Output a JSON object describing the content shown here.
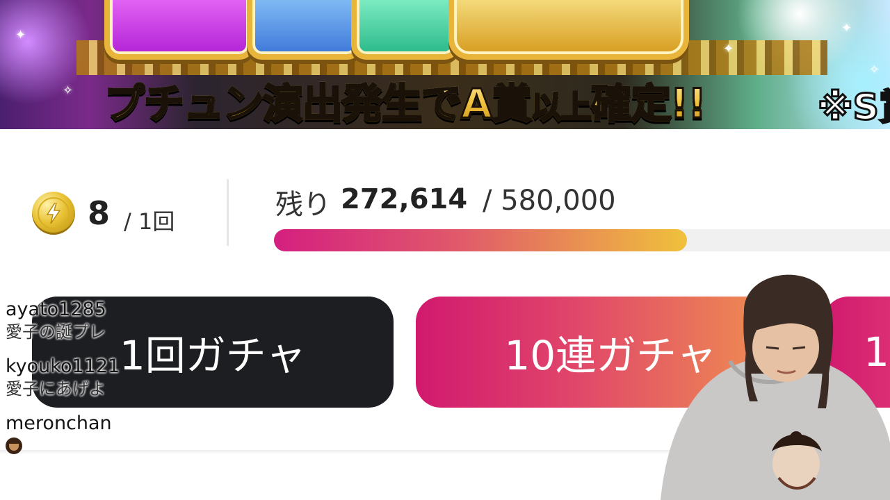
{
  "banner": {
    "caption_main": "プチュン演出発生でA賞",
    "caption_small": "以上",
    "caption_end": "確定!!",
    "note": "※S賞"
  },
  "gacha_cost": {
    "value": "8",
    "unit": "/ 1回",
    "icon": "lightning-coin-icon"
  },
  "stock": {
    "remaining_label": "残り",
    "remaining_value": "272,614",
    "total": "/ 580,000",
    "remaining_fraction": 0.47
  },
  "buttons": {
    "single": "1回ガチャ",
    "ten": "10連ガチャ",
    "third": "1"
  },
  "chat": [
    {
      "user": "ayato1285",
      "text": "愛子の誕プレ"
    },
    {
      "user": "kyouko1121",
      "text": "愛子にあげよ"
    },
    {
      "user": "meronchan",
      "text": "",
      "icon": "person-emoji-icon"
    }
  ],
  "colors": {
    "accent_start": "#d1196f",
    "accent_end": "#f19a4e",
    "progress_end": "#f0c13c",
    "dark_button": "#1d1e22",
    "coin": "#e8c133"
  }
}
